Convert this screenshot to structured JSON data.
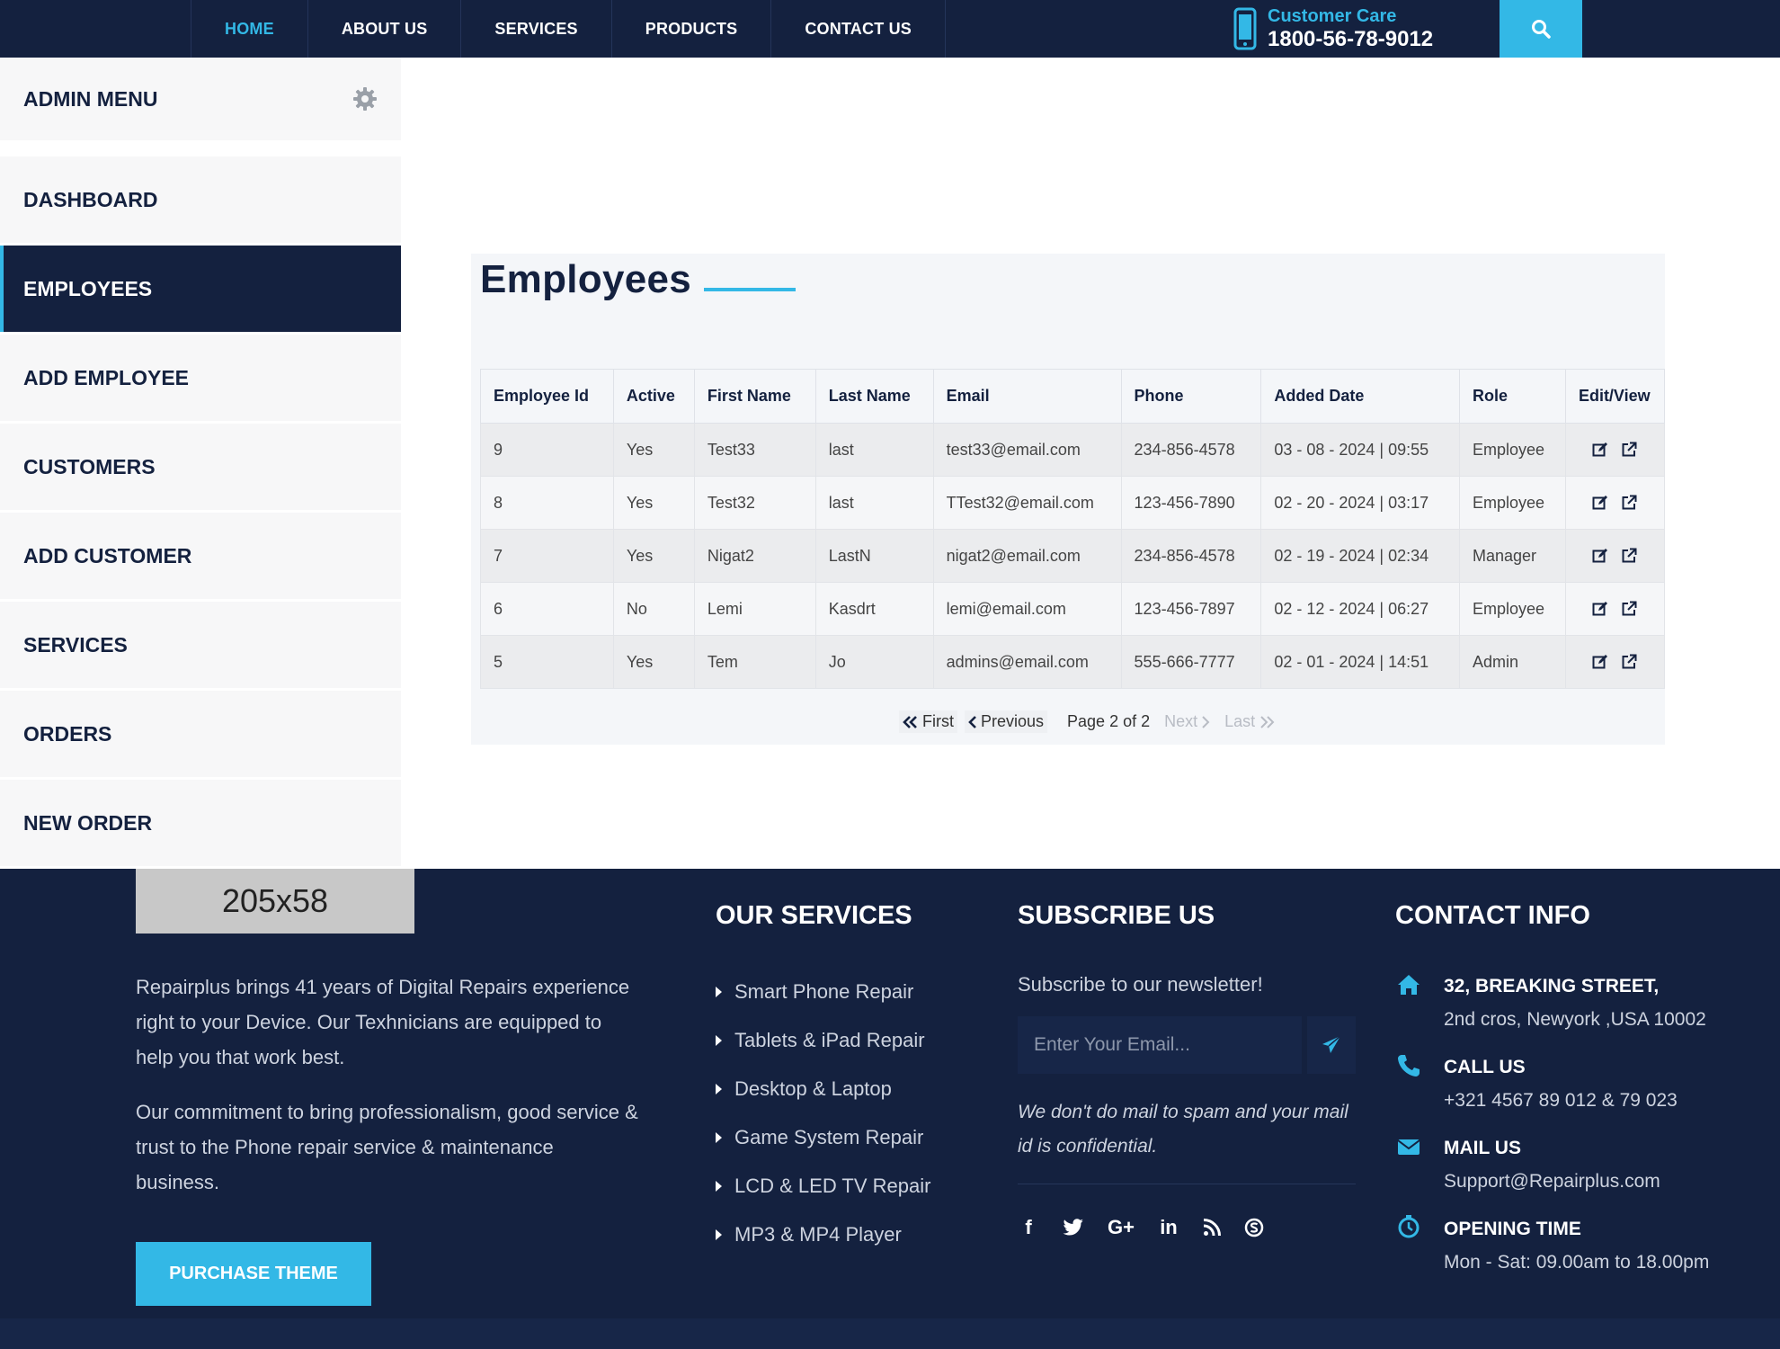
{
  "nav": {
    "items": [
      {
        "label": "HOME",
        "active": true
      },
      {
        "label": "ABOUT US",
        "active": false
      },
      {
        "label": "SERVICES",
        "active": false
      },
      {
        "label": "PRODUCTS",
        "active": false
      },
      {
        "label": "CONTACT US",
        "active": false
      }
    ],
    "care_label": "Customer Care",
    "care_number": "1800-56-78-9012"
  },
  "sidebar": {
    "title": "ADMIN MENU",
    "items": [
      {
        "label": "DASHBOARD",
        "active": false
      },
      {
        "label": "EMPLOYEES",
        "active": true
      },
      {
        "label": "ADD EMPLOYEE",
        "active": false
      },
      {
        "label": "CUSTOMERS",
        "active": false
      },
      {
        "label": "ADD CUSTOMER",
        "active": false
      },
      {
        "label": "SERVICES",
        "active": false
      },
      {
        "label": "ORDERS",
        "active": false
      },
      {
        "label": "NEW ORDER",
        "active": false
      }
    ]
  },
  "main": {
    "title": "Employees",
    "table": {
      "columns": [
        "Employee Id",
        "Active",
        "First Name",
        "Last Name",
        "Email",
        "Phone",
        "Added Date",
        "Role",
        "Edit/View"
      ],
      "rows": [
        [
          "9",
          "Yes",
          "Test33",
          "last",
          "test33@email.com",
          "234-856-4578",
          "03 - 08 - 2024 | 09:55",
          "Employee"
        ],
        [
          "8",
          "Yes",
          "Test32",
          "last",
          "TTest32@email.com",
          "123-456-7890",
          "02 - 20 - 2024 | 03:17",
          "Employee"
        ],
        [
          "7",
          "Yes",
          "Nigat2",
          "LastN",
          "nigat2@email.com",
          "234-856-4578",
          "02 - 19 - 2024 | 02:34",
          "Manager"
        ],
        [
          "6",
          "No",
          "Lemi",
          "Kasdrt",
          "lemi@email.com",
          "123-456-7897",
          "02 - 12 - 2024 | 06:27",
          "Employee"
        ],
        [
          "5",
          "Yes",
          "Tem",
          "Jo",
          "admins@email.com",
          "555-666-7777",
          "02 - 01 - 2024 | 14:51",
          "Admin"
        ]
      ]
    },
    "pagination": {
      "first": "First",
      "previous": "Previous",
      "page_label": "Page 2 of 2",
      "next": "Next",
      "last": "Last"
    }
  },
  "footer": {
    "logo_placeholder": "205x58",
    "about_p1": "Repairplus brings 41 years of Digital Repairs experience right to your Device. Our Texhnicians are equipped to help you that work best.",
    "about_p2": "Our commitment to bring professionalism, good service & trust to the Phone repair service & maintenance business.",
    "purchase_label": "PURCHASE THEME",
    "services_title": "OUR SERVICES",
    "services": [
      "Smart Phone Repair",
      "Tablets & iPad Repair",
      "Desktop & Laptop",
      "Game System Repair",
      "LCD & LED TV Repair",
      "MP3 & MP4 Player"
    ],
    "subscribe_title": "SUBSCRIBE US",
    "subscribe_text": "Subscribe to our newsletter!",
    "email_placeholder": "Enter Your Email...",
    "subscribe_note": "We don't do mail to spam and your mail id is confidential.",
    "socials": [
      "f",
      "G+",
      "in"
    ],
    "contact_title": "CONTACT INFO",
    "address_line1": "32, BREAKING STREET,",
    "address_line2": "2nd cros, Newyork ,USA 10002",
    "call_label": "CALL US",
    "call_value": "+321 4567 89 012 & 79 023",
    "mail_label": "MAIL US",
    "mail_value": "Support@Repairplus.com",
    "hours_label": "OPENING TIME",
    "hours_value": "Mon - Sat: 09.00am to 18.00pm"
  },
  "colors": {
    "navy": "#14213f",
    "accent": "#33b8e6",
    "panel": "#f4f6f9"
  }
}
